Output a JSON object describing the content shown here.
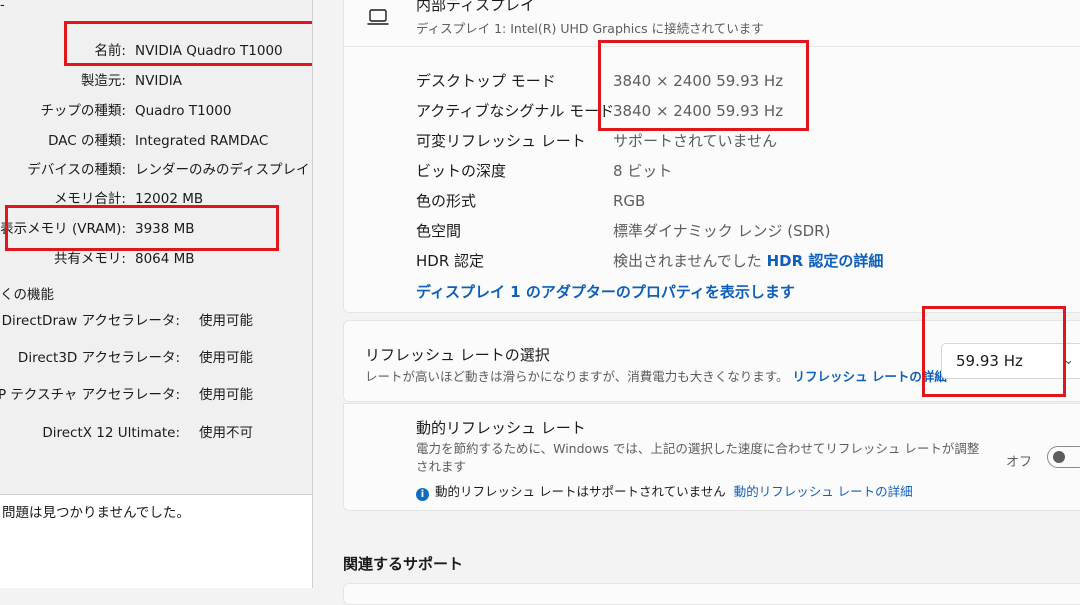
{
  "dxdiag": {
    "top_mark": "-",
    "fields": [
      {
        "label": "名前:",
        "value": "NVIDIA Quadro T1000"
      },
      {
        "label": "製造元:",
        "value": "NVIDIA"
      },
      {
        "label": "チップの種類:",
        "value": "Quadro T1000"
      },
      {
        "label": "DAC の種類:",
        "value": "Integrated RAMDAC"
      },
      {
        "label": "デバイスの種類:",
        "value": "レンダーのみのディスプレイ デバイ"
      },
      {
        "label": "メモリ合計:",
        "value": "12002 MB"
      },
      {
        "label": "表示メモリ (VRAM):",
        "value": "3938 MB"
      },
      {
        "label": "共有メモリ:",
        "value": "8064 MB"
      }
    ],
    "features_heading": "くの機能",
    "features": [
      {
        "label": "DirectDraw アクセラレータ:",
        "value": "使用可能"
      },
      {
        "label": "Direct3D アクセラレータ:",
        "value": "使用可能"
      },
      {
        "label": "AGP テクスチャ アクセラレータ:",
        "value": "使用可能"
      },
      {
        "label": "DirectX 12 Ultimate:",
        "value": "使用不可"
      }
    ],
    "notes": "問題は見つかりませんでした。"
  },
  "settings": {
    "display": {
      "icon": "laptop-icon",
      "title": "内部ディスプレイ",
      "subtitle": "ディスプレイ 1: Intel(R) UHD Graphics に接続されています"
    },
    "properties": [
      {
        "label": "デスクトップ モード",
        "value": "3840 × 2400 59.93 Hz"
      },
      {
        "label": "アクティブなシグナル モード",
        "value": "3840 × 2400 59.93 Hz"
      },
      {
        "label": "可変リフレッシュ レート",
        "value": "サポートされていません"
      },
      {
        "label": "ビットの深度",
        "value": "8 ビット"
      },
      {
        "label": "色の形式",
        "value": "RGB"
      },
      {
        "label": "色空間",
        "value": "標準ダイナミック レンジ (SDR)"
      },
      {
        "label": "HDR 認定",
        "value": "検出されませんでした",
        "link": "HDR 認定の詳細"
      }
    ],
    "adapter_link": "ディスプレイ 1 のアダプターのプロパティを表示します",
    "refresh": {
      "title": "リフレッシュ レートの選択",
      "description": "レートが高いほど動きは滑らかになりますが、消費電力も大きくなります。",
      "link": "リフレッシュ レートの詳細",
      "selected": "59.93 Hz",
      "chevron": "chevron-down-icon"
    },
    "dynamic_refresh": {
      "title": "動的リフレッシュ レート",
      "description": "電力を節約するために、Windows では、上記の選択した速度に合わせてリフレッシュ レートが調整されます",
      "info_text": "動的リフレッシュ レートはサポートされていません",
      "info_link": "動的リフレッシュ レートの詳細",
      "state_label": "オフ",
      "enabled": false
    },
    "support_heading": "関連するサポート"
  },
  "highlight_color": "#e0161c"
}
